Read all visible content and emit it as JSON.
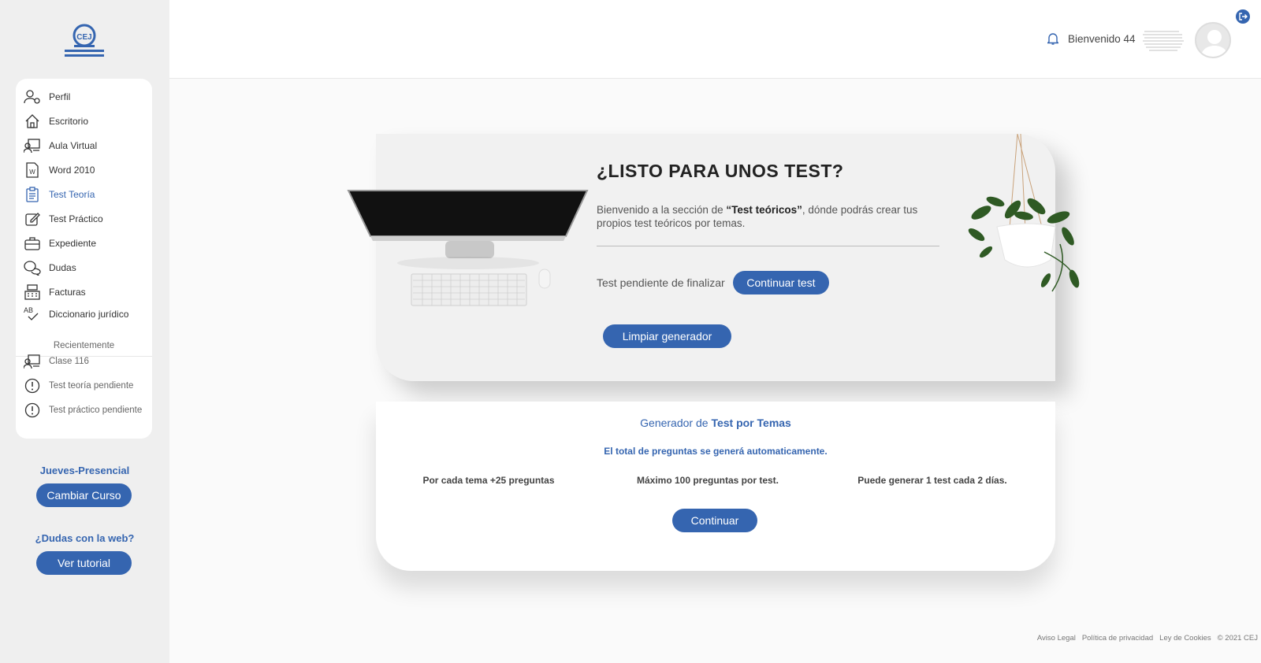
{
  "sidebar": {
    "logo_text": "CEJ",
    "items": [
      {
        "label": "Perfil",
        "icon": "user-gear-icon"
      },
      {
        "label": "Escritorio",
        "icon": "home-icon"
      },
      {
        "label": "Aula Virtual",
        "icon": "classroom-icon"
      },
      {
        "label": "Word 2010",
        "icon": "word-document-icon"
      },
      {
        "label": "Test Teoría",
        "icon": "clipboard-icon",
        "active": true
      },
      {
        "label": "Test Práctico",
        "icon": "edit-icon"
      },
      {
        "label": "Expediente",
        "icon": "briefcase-icon"
      },
      {
        "label": "Dudas",
        "icon": "chat-bubbles-icon"
      },
      {
        "label": "Facturas",
        "icon": "register-icon"
      },
      {
        "label": "Diccionario jurídico",
        "icon": "spellcheck-icon"
      }
    ],
    "recent_title": "Recientemente",
    "recent_items": [
      {
        "label": "Clase 116",
        "icon": "classroom-icon"
      },
      {
        "label": "Test teoría pendiente",
        "icon": "alert-circle-icon"
      },
      {
        "label": "Test práctico pendiente",
        "icon": "alert-circle-icon"
      }
    ],
    "course_label": "Jueves-Presencial",
    "change_course_button": "Cambiar Curso",
    "help_label": "¿Dudas con la web?",
    "tutorial_button": "Ver tutorial"
  },
  "header": {
    "welcome": "Bienvenido 44"
  },
  "hero": {
    "title": "¿LISTO PARA UNOS TEST?",
    "intro_prefix": "Bienvenido a la sección de ",
    "intro_bold": "“Test teóricos”",
    "intro_suffix": ", dónde podrás crear tus propios test teóricos por temas.",
    "pending_label": "Test pendiente de finalizar",
    "continue_test_button": "Continuar test",
    "clear_button": "Limpiar generador"
  },
  "generator": {
    "title_prefix": "Generador de ",
    "title_bold": "Test por Temas",
    "subtitle": "El total de preguntas se generá automaticamente.",
    "notes": [
      "Por cada tema +25 preguntas",
      "Máximo 100 preguntas por test.",
      "Puede generar 1 test cada 2 días."
    ],
    "continue_button": "Continuar"
  },
  "footer": {
    "links": [
      "Aviso Legal",
      "Política de privacidad",
      "Ley de Cookies"
    ],
    "copyright": "© 2021 CEJ"
  },
  "colors": {
    "accent": "#3565b0",
    "sidebar_bg": "#efefef",
    "card_bg": "#f1f1f1"
  }
}
